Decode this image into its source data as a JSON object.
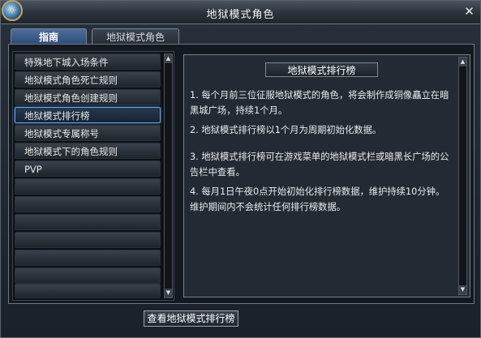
{
  "window": {
    "title": "地狱模式角色",
    "emblem_glyph": "☼",
    "close_glyph": "✕"
  },
  "tabs": [
    {
      "label": "指南",
      "active": true
    },
    {
      "label": "地狱模式角色",
      "active": false
    }
  ],
  "guide_list": {
    "items": [
      "特殊地下城入场条件",
      "地狱模式角色死亡规则",
      "地狱模式角色创建规则",
      "地狱模式排行榜",
      "地狱模式专属称号",
      "地狱模式下的角色规则",
      "PVP"
    ],
    "selected_index": 3,
    "empty_rows": 7
  },
  "scroll": {
    "up_glyph": "▲",
    "down_glyph": "▼"
  },
  "detail": {
    "title": "地狱模式排行榜",
    "paragraphs": [
      "1. 每个月前三位征服地狱模式的角色，将会制作成铜像矗立在暗黑城广场，持续1个月。",
      "2. 地狱模式排行榜以1个月为周期初始化数据。",
      "3. 地狱模式排行榜可在游戏菜单的地狱模式栏或暗黑长广场的公告栏中查看。",
      "4. 每月1日午夜0点开始初始化排行榜数据，维护持续10分钟。维护期间内不会统计任何排行榜数据。"
    ]
  },
  "footer": {
    "button_label": "查看地狱模式排行榜"
  },
  "colors": {
    "selected_border": "#6aa3e6",
    "active_tab": "#2d4a73",
    "panel_bg": "#232a33"
  }
}
